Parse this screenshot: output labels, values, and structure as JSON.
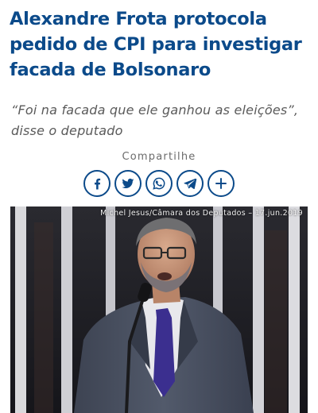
{
  "article": {
    "headline": "Alexandre Frota protocola pedido de CPI para investigar facada de Bolsonaro",
    "subtitle": "“Foi na facada que ele ganhou as eleições”, disse o deputado"
  },
  "share": {
    "label": "Compartilhe",
    "buttons": [
      {
        "icon": "facebook-icon"
      },
      {
        "icon": "twitter-icon"
      },
      {
        "icon": "whatsapp-icon"
      },
      {
        "icon": "telegram-icon"
      },
      {
        "icon": "plus-icon"
      }
    ]
  },
  "photo": {
    "credit": "Michel Jesus/Câmara dos Deputados – 17.jun.2019"
  },
  "colors": {
    "accent": "#0b4a8a",
    "subtitle": "#5a5a5a",
    "share_label": "#6b6b6b"
  }
}
